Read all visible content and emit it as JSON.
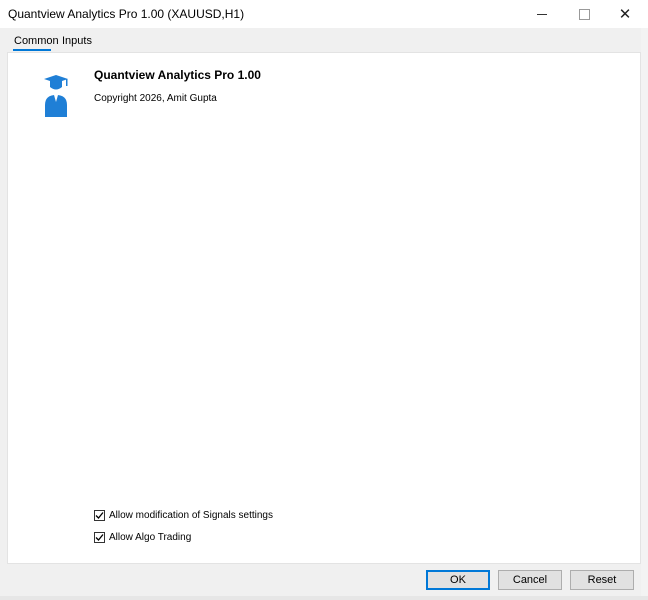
{
  "window": {
    "title": "Quantview Analytics Pro 1.00 (XAUUSD,H1)",
    "controls": {
      "close_symbol": "✕"
    }
  },
  "tabs": [
    {
      "label": "Common",
      "active": true
    },
    {
      "label": "Inputs",
      "active": false
    }
  ],
  "product": {
    "name": "Quantview Analytics Pro 1.00",
    "copyright": "Copyright 2026, Amit Gupta",
    "logo_icon": "graduate-icon"
  },
  "options": [
    {
      "label": "Allow modification of Signals settings",
      "checked": true
    },
    {
      "label": "Allow Algo Trading",
      "checked": true
    }
  ],
  "buttons": {
    "ok": "OK",
    "cancel": "Cancel",
    "reset": "Reset"
  },
  "colors": {
    "accent": "#0078d7",
    "logo": "#1f7fd6"
  }
}
